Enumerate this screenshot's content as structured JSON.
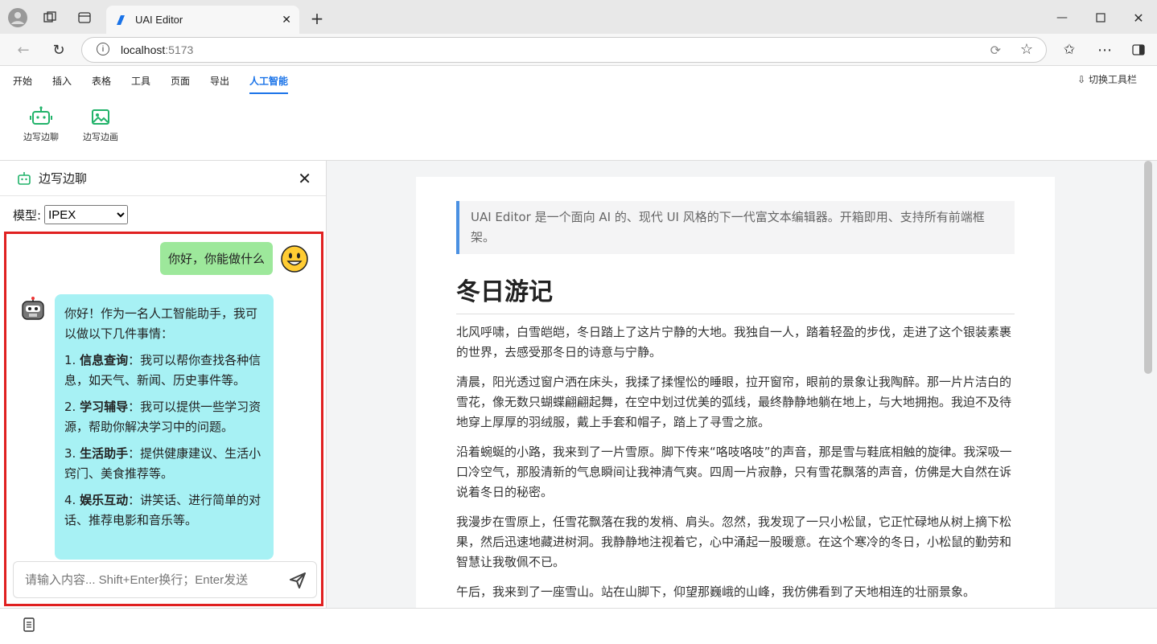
{
  "browser": {
    "tab_title": "UAI Editor",
    "url_host": "localhost",
    "url_port": ":5173"
  },
  "menu": {
    "items": [
      "开始",
      "插入",
      "表格",
      "工具",
      "页面",
      "导出",
      "人工智能"
    ],
    "active": "人工智能",
    "switch_toolbar": "切换工具栏"
  },
  "ribbon": {
    "chat_label": "边写边聊",
    "draw_label": "边写边画"
  },
  "chat": {
    "title": "边写边聊",
    "model_label": "模型:",
    "model_value": "IPEX",
    "user_message": "你好，你能做什么",
    "bot_intro": "你好！作为一名人工智能助手，我可以做以下几件事情：",
    "bot_items": [
      {
        "num": "1.",
        "title": "信息查询",
        "text": "：我可以帮你查找各种信息，如天气、新闻、历史事件等。"
      },
      {
        "num": "2.",
        "title": "学习辅导",
        "text": "：我可以提供一些学习资源，帮助你解决学习中的问题。"
      },
      {
        "num": "3.",
        "title": "生活助手",
        "text": "：提供健康建议、生活小窍门、美食推荐等。"
      },
      {
        "num": "4.",
        "title": "娱乐互动",
        "text": "：讲笑话、进行简单的对话、推荐电影和音乐等。"
      }
    ],
    "input_placeholder": "请输入内容... Shift+Enter换行；Enter发送"
  },
  "document": {
    "quote": "UAI Editor 是一个面向 AI 的、现代 UI 风格的下一代富文本编辑器。开箱即用、支持所有前端框架。",
    "heading": "冬日游记",
    "paragraphs": [
      "北风呼啸，白雪皑皑，冬日踏上了这片宁静的大地。我独自一人，踏着轻盈的步伐，走进了这个银装素裹的世界，去感受那冬日的诗意与宁静。",
      "清晨，阳光透过窗户洒在床头，我揉了揉惺忪的睡眼，拉开窗帘，眼前的景象让我陶醉。那一片片洁白的雪花，像无数只蝴蝶翩翩起舞，在空中划过优美的弧线，最终静静地躺在地上，与大地拥抱。我迫不及待地穿上厚厚的羽绒服，戴上手套和帽子，踏上了寻雪之旅。",
      "沿着蜿蜒的小路，我来到了一片雪原。脚下传来“咯吱咯吱”的声音，那是雪与鞋底相触的旋律。我深吸一口冷空气，那股清新的气息瞬间让我神清气爽。四周一片寂静，只有雪花飘落的声音，仿佛是大自然在诉说着冬日的秘密。",
      "我漫步在雪原上，任雪花飘落在我的发梢、肩头。忽然，我发现了一只小松鼠，它正忙碌地从树上摘下松果，然后迅速地藏进树洞。我静静地注视着它，心中涌起一股暖意。在这个寒冷的冬日，小松鼠的勤劳和智慧让我敬佩不已。",
      "午后，我来到了一座雪山。站在山脚下，仰望那巍峨的山峰，我仿佛看到了天地相连的壮丽景象。"
    ]
  }
}
